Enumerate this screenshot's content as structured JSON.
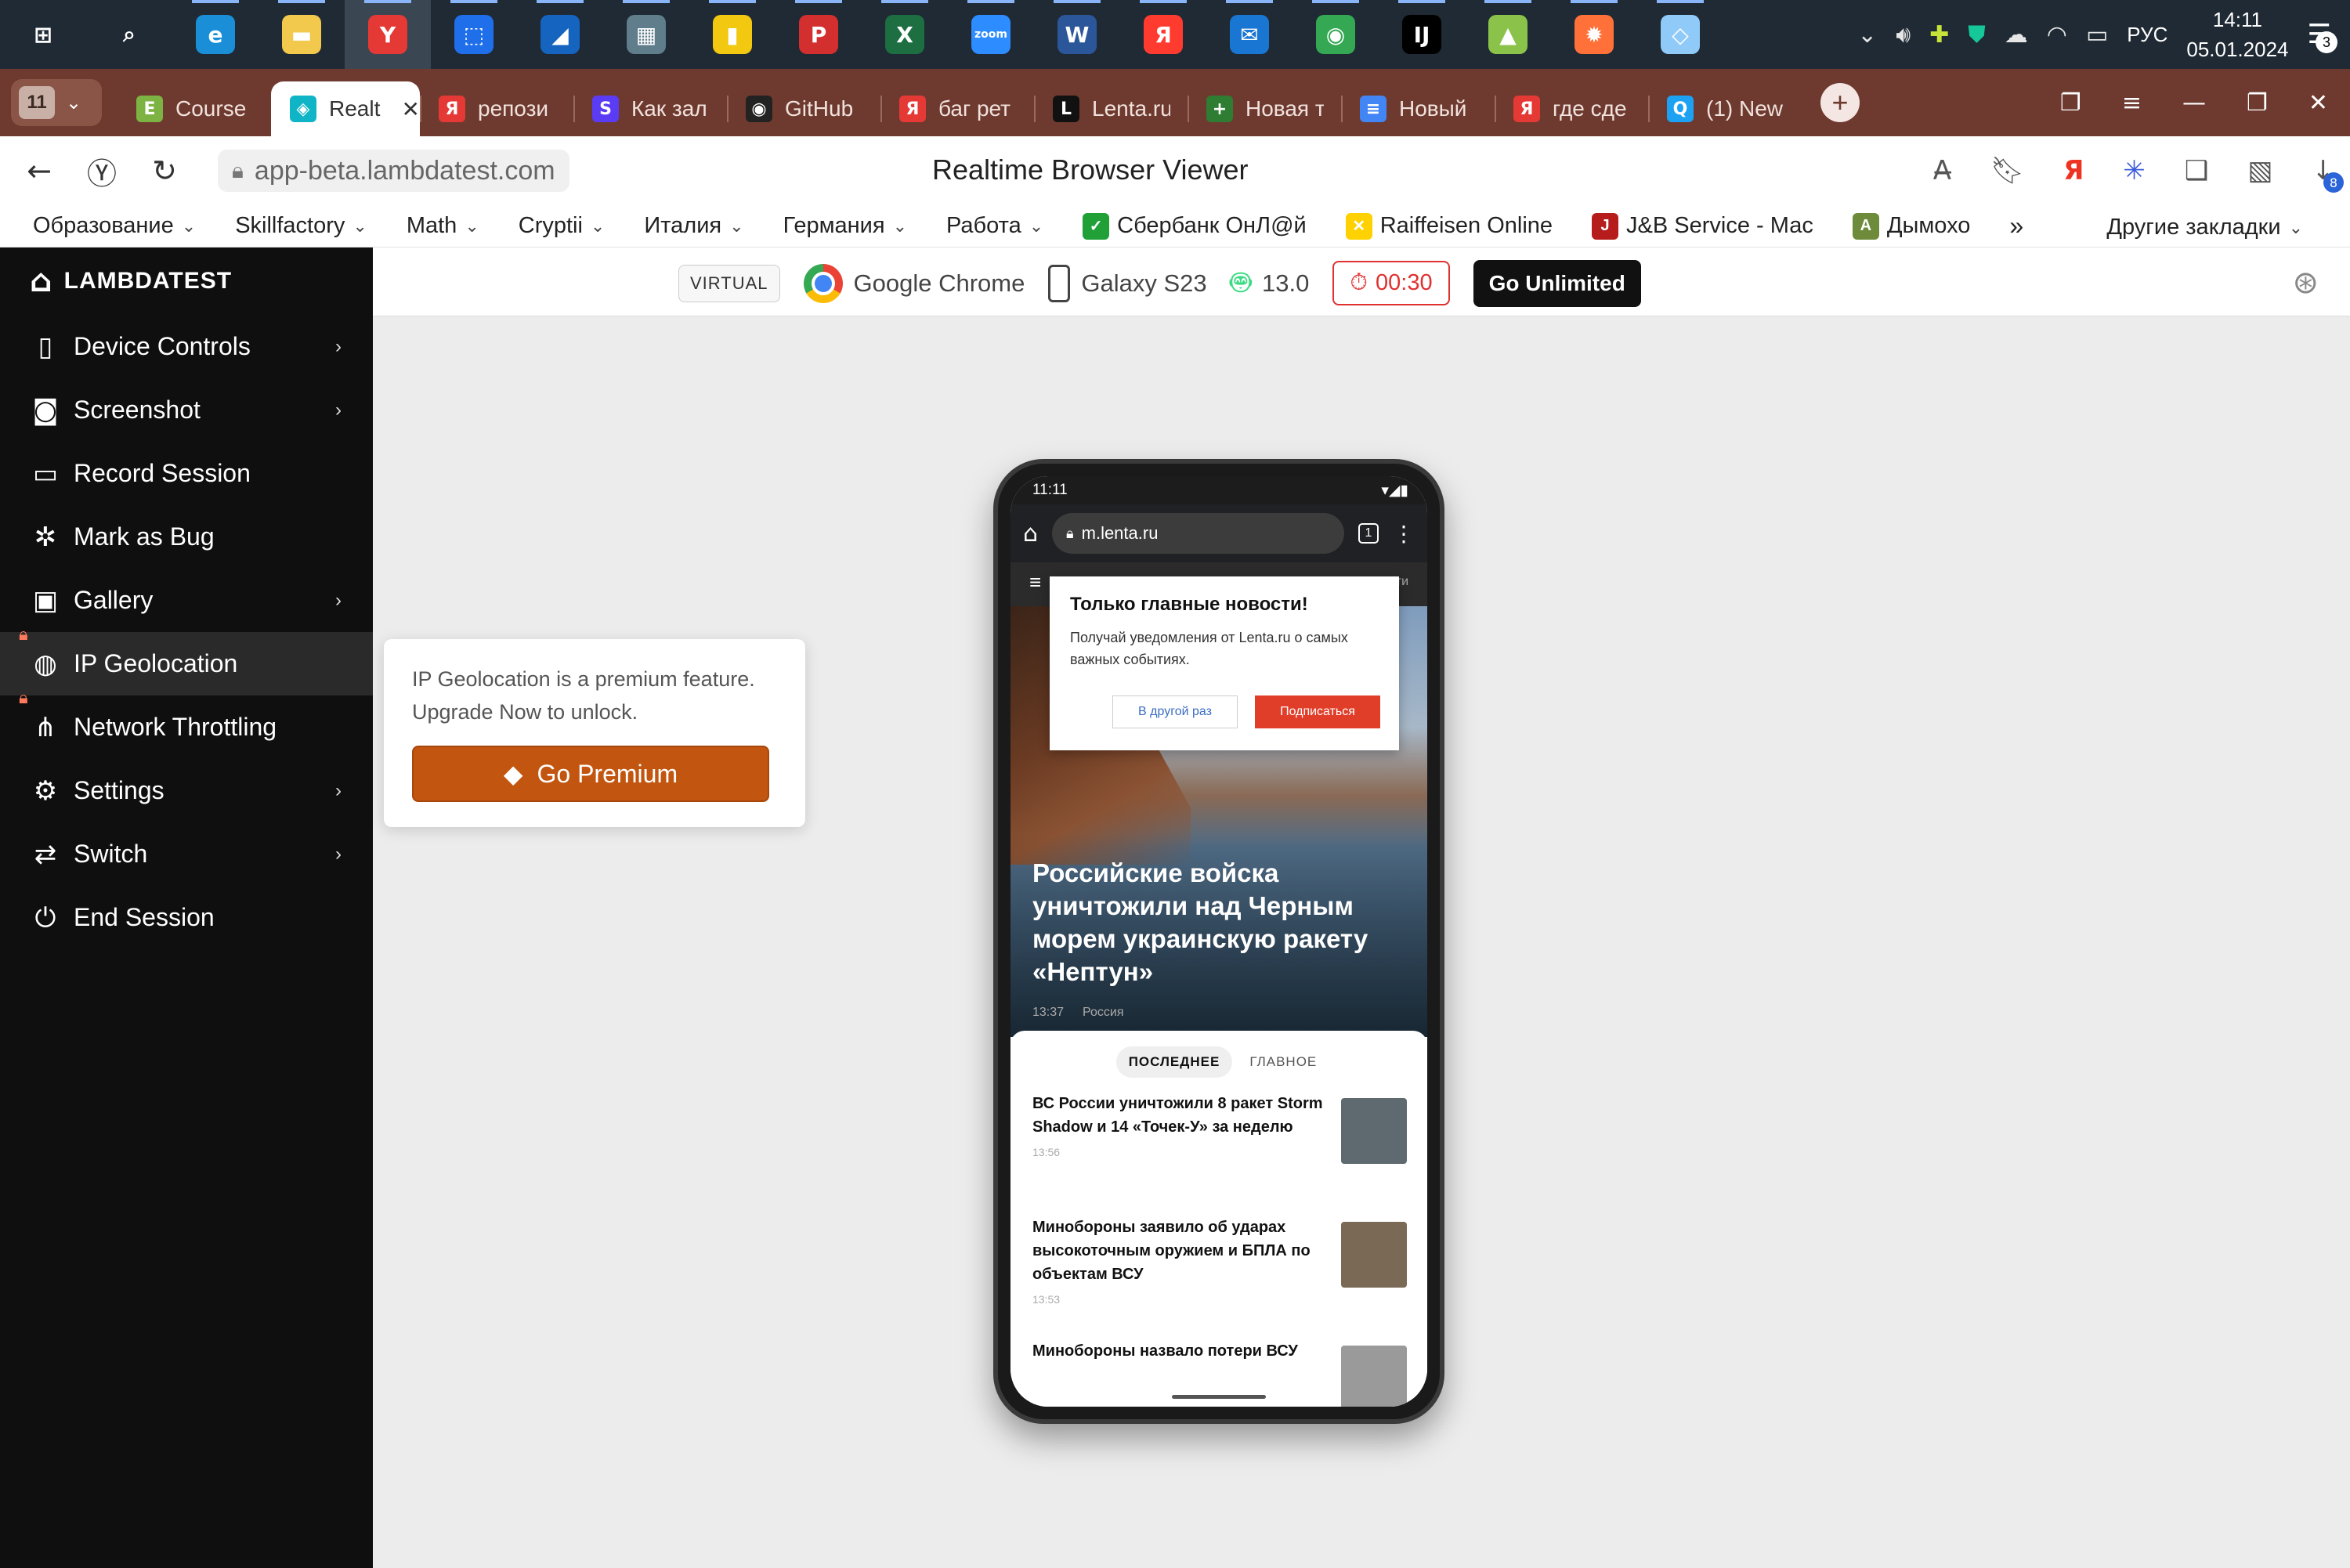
{
  "taskbar": {
    "apps": [
      {
        "name": "start",
        "glyph": "⊞",
        "color": "#1f2a34"
      },
      {
        "name": "search",
        "glyph": "⌕",
        "color": "#1f2a34"
      },
      {
        "name": "edge",
        "glyph": "e",
        "color": "#1a8fd8"
      },
      {
        "name": "explorer",
        "glyph": "▬",
        "color": "#f2c94c"
      },
      {
        "name": "yandex",
        "glyph": "Y",
        "color": "#e53935"
      },
      {
        "name": "snipping",
        "glyph": "⬚",
        "color": "#1f6feb"
      },
      {
        "name": "onedrive-like",
        "glyph": "◢",
        "color": "#1565c0"
      },
      {
        "name": "calculator",
        "glyph": "▦",
        "color": "#607d8b"
      },
      {
        "name": "powerbi",
        "glyph": "▮",
        "color": "#f2c811"
      },
      {
        "name": "psiphon",
        "glyph": "P",
        "color": "#d32f2f"
      },
      {
        "name": "excel",
        "glyph": "X",
        "color": "#1d6f42"
      },
      {
        "name": "zoom",
        "glyph": "zoom",
        "color": "#2d8cff"
      },
      {
        "name": "word",
        "glyph": "W",
        "color": "#2b579a"
      },
      {
        "name": "yandex-browser",
        "glyph": "Я",
        "color": "#ff3b30"
      },
      {
        "name": "mail",
        "glyph": "✉",
        "color": "#1976d2"
      },
      {
        "name": "chrome",
        "glyph": "◉",
        "color": "#34a853"
      },
      {
        "name": "intellij",
        "glyph": "IJ",
        "color": "#000000"
      },
      {
        "name": "image-viewer",
        "glyph": "▲",
        "color": "#8bc34a"
      },
      {
        "name": "firefox",
        "glyph": "✹",
        "color": "#ff7139"
      },
      {
        "name": "notes",
        "glyph": "◇",
        "color": "#90caf9"
      }
    ],
    "tray": {
      "lang": "РУС",
      "time": "14:11",
      "date": "05.01.2024",
      "notifications": "3"
    }
  },
  "browser": {
    "tab_count": "11",
    "tabs": [
      {
        "title": "Course",
        "icon": "E",
        "color": "#7cb342"
      },
      {
        "title": "Realt",
        "icon": "◈",
        "color": "#0fb5c7",
        "active": true
      },
      {
        "title": "репози",
        "icon": "Я",
        "color": "#e53935"
      },
      {
        "title": "Как зал",
        "icon": "S",
        "color": "#5b3cf5"
      },
      {
        "title": "GitHub",
        "icon": "◉",
        "color": "#222222"
      },
      {
        "title": "баг рет",
        "icon": "Я",
        "color": "#e53935"
      },
      {
        "title": "Lenta.ru",
        "icon": "L",
        "color": "#111111"
      },
      {
        "title": "Новая т",
        "icon": "+",
        "color": "#2e7d32"
      },
      {
        "title": "Новый",
        "icon": "≡",
        "color": "#4285f4"
      },
      {
        "title": "где сде",
        "icon": "Я",
        "color": "#e53935"
      },
      {
        "title": "(1) New",
        "icon": "Q",
        "color": "#1da1f2"
      }
    ],
    "url": "app-beta.lambdatest.com",
    "page_title": "Realtime Browser Viewer",
    "downloads_badge": "8",
    "bookmarks": [
      {
        "label": "Образование",
        "folder": true
      },
      {
        "label": "Skillfactory",
        "folder": true
      },
      {
        "label": "Math",
        "folder": true
      },
      {
        "label": "Cryptii",
        "folder": true
      },
      {
        "label": "Италия",
        "folder": true
      },
      {
        "label": "Германия",
        "folder": true
      },
      {
        "label": "Работа",
        "folder": true
      },
      {
        "label": "Сбербанк ОнЛ@й",
        "icon": "✓",
        "color": "#21a038"
      },
      {
        "label": "Raiffeisen Online",
        "icon": "✕",
        "color": "#ffd100"
      },
      {
        "label": "J&B Service - Мас",
        "icon": "J",
        "color": "#b71c1c"
      },
      {
        "label": "Дымохо",
        "icon": "A",
        "color": "#6d8b3a"
      }
    ],
    "bookmarks_more": "»",
    "other_bookmarks": "Другие закладки"
  },
  "lambdatest": {
    "logo": "LAMBDATEST",
    "menu": [
      {
        "label": "Device Controls",
        "icon": "▯",
        "has_arrow": true
      },
      {
        "label": "Screenshot",
        "icon": "◙",
        "has_arrow": true
      },
      {
        "label": "Record Session",
        "icon": "▭",
        "has_arrow": false
      },
      {
        "label": "Mark as Bug",
        "icon": "✲",
        "has_arrow": false
      },
      {
        "label": "Gallery",
        "icon": "▣",
        "has_arrow": true
      },
      {
        "label": "IP Geolocation",
        "icon": "◍",
        "has_arrow": false,
        "locked": true,
        "hover": true
      },
      {
        "label": "Network Throttling",
        "icon": "⋔",
        "has_arrow": false,
        "locked": true
      },
      {
        "label": "Settings",
        "icon": "⚙",
        "has_arrow": true
      },
      {
        "label": "Switch",
        "icon": "⇄",
        "has_arrow": true
      },
      {
        "label": "End Session",
        "icon": "⏻",
        "has_arrow": false
      }
    ],
    "session": {
      "mode": "VIRTUAL",
      "browser": "Google Chrome",
      "device": "Galaxy S23",
      "os_version": "13.0",
      "timer": "00:30",
      "cta": "Go Unlimited"
    },
    "tooltip": {
      "message": "IP Geolocation is a premium feature. Upgrade Now to unlock.",
      "button": "Go Premium"
    }
  },
  "phone": {
    "status_time": "11:11",
    "url": "m.lenta.ru",
    "tab_count": "1",
    "nav_tail": "ти",
    "popup": {
      "title": "Только главные новости!",
      "text": "Получай уведомления от Lenta.ru о самых важных событиях.",
      "later": "В другой раз",
      "subscribe": "Подписаться"
    },
    "hero": {
      "headline": "Российские войска уничтожили над Черным морем украинскую ракету «Нептун»",
      "time": "13:37",
      "rubric": "Россия"
    },
    "feed_tabs": [
      "ПОСЛЕДНЕЕ",
      "ГЛАВНОЕ"
    ],
    "news": [
      {
        "title": "ВС России уничтожили 8 ракет Storm Shadow и 14 «Точек-У» за неделю",
        "time": "13:56",
        "thumb": "#5f6a70"
      },
      {
        "title": "Минобороны заявило об ударах высокоточным оружием и БПЛА по объектам ВСУ",
        "time": "13:53",
        "thumb": "#7a6a55"
      },
      {
        "title": "Минобороны назвало потери ВСУ",
        "time": "",
        "thumb": "#9a9a9a"
      }
    ]
  }
}
